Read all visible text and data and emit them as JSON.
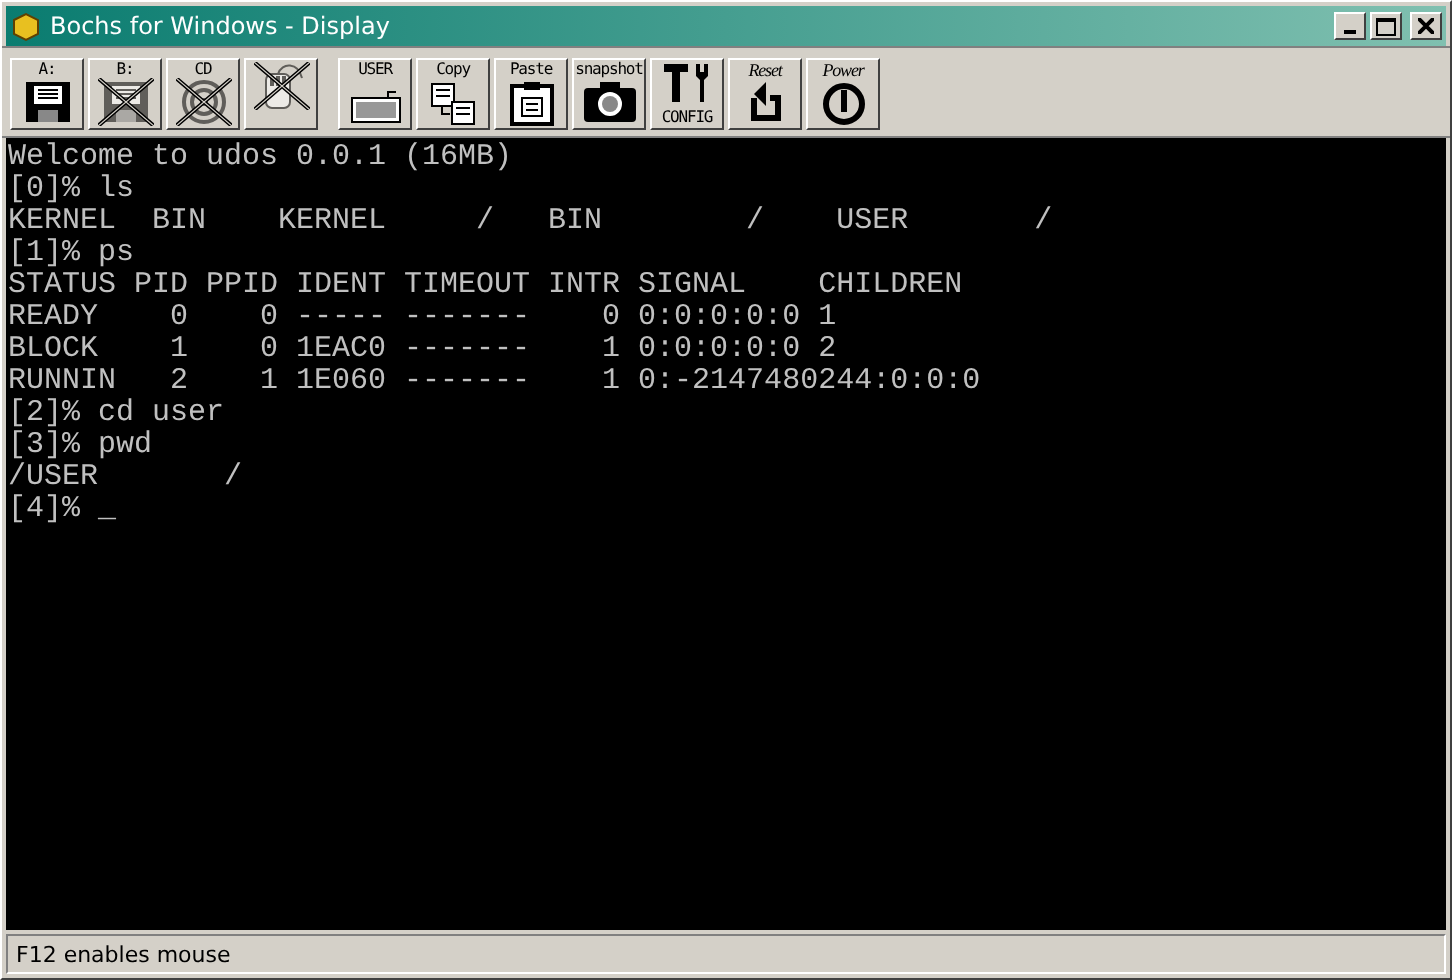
{
  "window": {
    "title": "Bochs for Windows - Display"
  },
  "toolbar": {
    "groups": [
      [
        {
          "kind": "floppy",
          "label": "A:",
          "disabled": false
        },
        {
          "kind": "floppy",
          "label": "B:",
          "disabled": true
        },
        {
          "kind": "cdrom",
          "label": "CD",
          "disabled": true
        },
        {
          "kind": "mouse",
          "disabled": true
        }
      ],
      [
        {
          "kind": "keyboard",
          "label": "USER",
          "disabled": false
        },
        {
          "kind": "copy",
          "label": "Copy",
          "disabled": false
        },
        {
          "kind": "paste",
          "label": "Paste",
          "disabled": false
        },
        {
          "kind": "snapshot",
          "label": "snapshot",
          "disabled": false
        },
        {
          "kind": "config",
          "label": "CONFIG",
          "disabled": false
        },
        {
          "kind": "reset",
          "label": "Reset",
          "disabled": false
        },
        {
          "kind": "power",
          "label": "Power",
          "disabled": false
        }
      ]
    ]
  },
  "console": {
    "lines": [
      "Welcome to udos 0.0.1 (16MB)",
      "[0]% ls",
      "KERNEL  BIN    KERNEL     /   BIN        /    USER       /",
      "[1]% ps",
      "STATUS PID PPID IDENT TIMEOUT INTR SIGNAL    CHILDREN",
      "READY    0    0 ----- -------    0 0:0:0:0:0 1",
      "BLOCK    1    0 1EAC0 -------    1 0:0:0:0:0 2",
      "RUNNIN   2    1 1E060 -------    1 0:-2147480244:0:0:0",
      "[2]% cd user",
      "[3]% pwd",
      "/USER       /",
      "[4]% _"
    ]
  },
  "status_bar": {
    "text": "F12 enables mouse"
  }
}
